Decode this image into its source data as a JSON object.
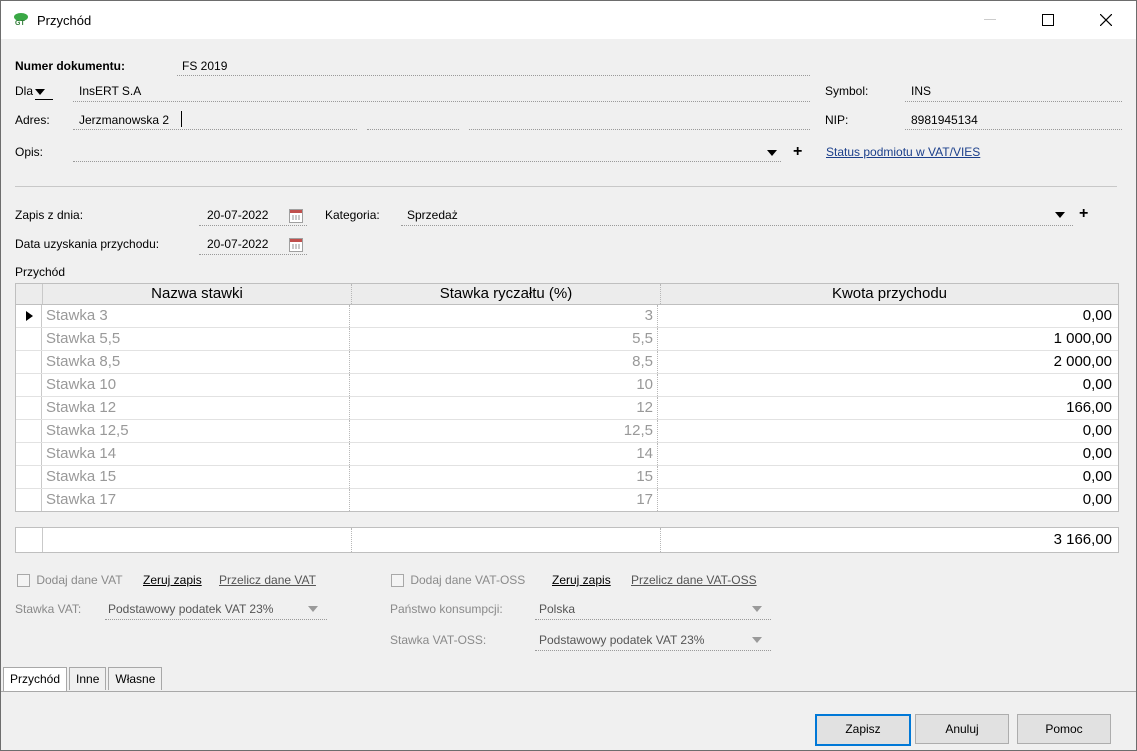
{
  "window": {
    "title": "Przychód"
  },
  "doc": {
    "number_label": "Numer dokumentu:",
    "number_value": "FS 2019",
    "dla_label": "Dla",
    "dla_value": "InsERT S.A",
    "adres_label": "Adres:",
    "adres_value": "Jerzmanowska 2",
    "opis_label": "Opis:",
    "opis_value": "",
    "symbol_label": "Symbol:",
    "symbol_value": "INS",
    "nip_label": "NIP:",
    "nip_value": "8981945134",
    "status_link": "Status podmiotu w VAT/VIES"
  },
  "entry": {
    "zapis_label": "Zapis z dnia:",
    "zapis_value": "20-07-2022",
    "data_label": "Data uzyskania przychodu:",
    "data_value": "20-07-2022",
    "kategoria_label": "Kategoria:",
    "kategoria_value": "Sprzedaż"
  },
  "grid": {
    "section_label": "Przychód",
    "headers": [
      "Nazwa stawki",
      "Stawka ryczałtu (%)",
      "Kwota przychodu"
    ],
    "rows": [
      {
        "name": "Stawka 3",
        "rate": "3",
        "amount": "0,00"
      },
      {
        "name": "Stawka 5,5",
        "rate": "5,5",
        "amount": "1 000,00"
      },
      {
        "name": "Stawka 8,5",
        "rate": "8,5",
        "amount": "2 000,00"
      },
      {
        "name": "Stawka 10",
        "rate": "10",
        "amount": "0,00"
      },
      {
        "name": "Stawka 12",
        "rate": "12",
        "amount": "166,00"
      },
      {
        "name": "Stawka 12,5",
        "rate": "12,5",
        "amount": "0,00"
      },
      {
        "name": "Stawka 14",
        "rate": "14",
        "amount": "0,00"
      },
      {
        "name": "Stawka 15",
        "rate": "15",
        "amount": "0,00"
      },
      {
        "name": "Stawka 17",
        "rate": "17",
        "amount": "0,00"
      }
    ],
    "total": "3 166,00"
  },
  "vat": {
    "add_label": "Dodaj dane VAT",
    "zeruj_label": "Zeruj zapis",
    "przelicz_label": "Przelicz dane VAT",
    "stawka_label": "Stawka VAT:",
    "stawka_value": "Podstawowy podatek VAT 23%"
  },
  "oss": {
    "add_label": "Dodaj dane VAT-OSS",
    "zeruj_label": "Zeruj zapis",
    "przelicz_label": "Przelicz dane VAT-OSS",
    "panstwo_label": "Państwo konsumpcji:",
    "panstwo_value": "Polska",
    "stawka_label": "Stawka VAT-OSS:",
    "stawka_value": "Podstawowy podatek VAT 23%"
  },
  "tabs": [
    "Przychód",
    "Inne",
    "Własne"
  ],
  "buttons": {
    "save": "Zapisz",
    "cancel": "Anuluj",
    "help": "Pomoc"
  }
}
